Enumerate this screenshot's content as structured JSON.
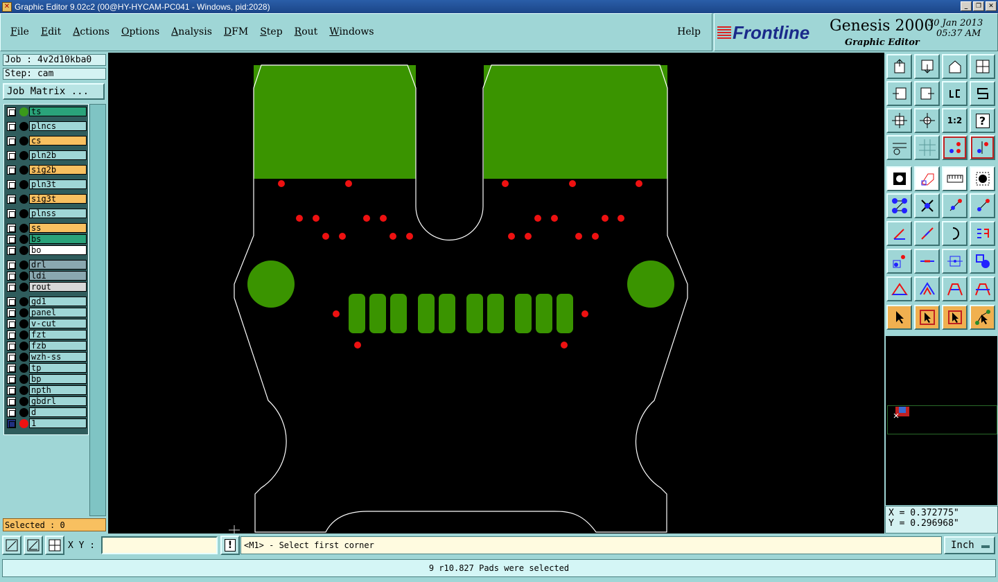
{
  "window": {
    "title": "Graphic Editor 9.02c2 (00@HY-HYCAM-PC041 - Windows, pid:2028)"
  },
  "menu": {
    "items": [
      "File",
      "Edit",
      "Actions",
      "Options",
      "Analysis",
      "DFM",
      "Step",
      "Rout",
      "Windows"
    ],
    "help": "Help"
  },
  "brand": {
    "logo": "Frontline",
    "product": "Genesis 2000",
    "subtitle": "Graphic Editor",
    "date": "30 Jan 2013",
    "time": "05:37 AM"
  },
  "job": {
    "job_label": "Job : 4v2d10kba0",
    "step_label": "Step: cam",
    "matrix_button": "Job Matrix ..."
  },
  "layers": [
    {
      "name": "ts",
      "color": "#2aa37a",
      "dot": "#3a9a1a"
    },
    {
      "name": "plncs",
      "color": "#9fd6d6",
      "dot": "#000000"
    },
    {
      "name": "cs",
      "color": "#f8c060",
      "dot": "#000000"
    },
    {
      "name": "pln2b",
      "color": "#9fd6d6",
      "dot": "#000000"
    },
    {
      "name": "sig2b",
      "color": "#f8c060",
      "dot": "#000000"
    },
    {
      "name": "pln3t",
      "color": "#9fd6d6",
      "dot": "#000000"
    },
    {
      "name": "sig3t",
      "color": "#f8c060",
      "dot": "#000000"
    },
    {
      "name": "plnss",
      "color": "#9fd6d6",
      "dot": "#000000"
    },
    {
      "name": "ss",
      "color": "#f8c060",
      "dot": "#000000"
    },
    {
      "name": "bs",
      "color": "#2aa37a",
      "dot": "#000000"
    },
    {
      "name": "bo",
      "color": "#ffffff",
      "dot": "#000000"
    },
    {
      "name": "drl",
      "color": "#8aa8b0",
      "dot": "#000000"
    },
    {
      "name": "ldi",
      "color": "#8aa8b0",
      "dot": "#000000"
    },
    {
      "name": "rout",
      "color": "#d8d8d8",
      "dot": "#000000"
    },
    {
      "name": "gd1",
      "color": "#9fd6d6",
      "dot": "#000000"
    },
    {
      "name": "panel",
      "color": "#9fd6d6",
      "dot": "#000000"
    },
    {
      "name": "v-cut",
      "color": "#9fd6d6",
      "dot": "#000000"
    },
    {
      "name": "fzt",
      "color": "#9fd6d6",
      "dot": "#000000"
    },
    {
      "name": "fzb",
      "color": "#9fd6d6",
      "dot": "#000000"
    },
    {
      "name": "wzh-ss",
      "color": "#9fd6d6",
      "dot": "#000000"
    },
    {
      "name": "tp",
      "color": "#9fd6d6",
      "dot": "#000000"
    },
    {
      "name": "bp",
      "color": "#9fd6d6",
      "dot": "#000000"
    },
    {
      "name": "npth",
      "color": "#9fd6d6",
      "dot": "#000000"
    },
    {
      "name": "gbdrl",
      "color": "#9fd6d6",
      "dot": "#000000"
    },
    {
      "name": "d",
      "color": "#9fd6d6",
      "dot": "#000000"
    },
    {
      "name": "1",
      "color": "#9fd6d6",
      "dot": "#ee1111"
    }
  ],
  "selected_label": "Selected : 0",
  "coords": {
    "x": "X = 0.372775\"",
    "y": "Y = 0.296968\""
  },
  "bottom": {
    "xy_label": "X Y :",
    "xy_value": "",
    "prompt": "<M1> - Select first corner",
    "units": "Inch"
  },
  "status": "9 r10.827 Pads were selected",
  "colors": {
    "board_fill": "#3a9400",
    "pad_red": "#ee1111",
    "outline": "#ffffff"
  }
}
